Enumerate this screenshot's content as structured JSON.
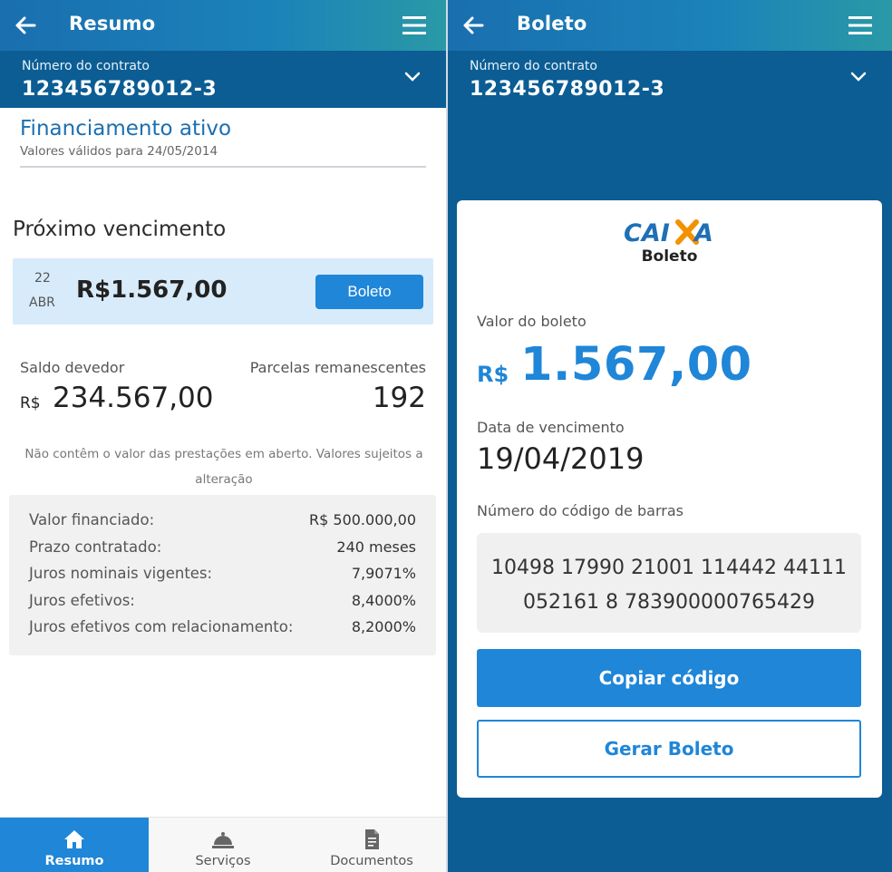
{
  "left": {
    "appbar": {
      "title": "Resumo"
    },
    "contract": {
      "label": "Número do contrato",
      "number": "123456789012-3"
    },
    "financing": {
      "title": "Financiamento ativo",
      "subtitle": "Valores válidos para 24/05/2014"
    },
    "next_due": {
      "title": "Próximo vencimento",
      "day": "22",
      "month": "ABR",
      "value": "R$1.567,00",
      "button_label": "Boleto"
    },
    "balance": {
      "label": "Saldo devedor",
      "currency": "R$",
      "value": "234.567,00",
      "remaining_label": "Parcelas remanescentes",
      "remaining_value": "192"
    },
    "note": "Não contêm o valor das prestações em aberto. Valores sujeitos a alteração",
    "details": [
      {
        "label": "Valor financiado:",
        "value": "R$ 500.000,00"
      },
      {
        "label": "Prazo contratado:",
        "value": "240 meses"
      },
      {
        "label": "Juros nominais vigentes:",
        "value": "7,9071%"
      },
      {
        "label": "Juros efetivos:",
        "value": "8,4000%"
      },
      {
        "label": "Juros efetivos com relacionamento:",
        "value": "8,2000%"
      }
    ],
    "bottom_nav": [
      {
        "label": "Resumo",
        "icon": "home-icon",
        "active": true
      },
      {
        "label": "Serviços",
        "icon": "service-bell-icon",
        "active": false
      },
      {
        "label": "Documentos",
        "icon": "document-icon",
        "active": false
      }
    ]
  },
  "right": {
    "appbar": {
      "title": "Boleto"
    },
    "contract": {
      "label": "Número do contrato",
      "number": "123456789012-3"
    },
    "card": {
      "logo_text": "CAIXA",
      "logo_subtitle": "Boleto",
      "value_label": "Valor do boleto",
      "value_currency": "R$",
      "value": "1.567,00",
      "due_label": "Data de vencimento",
      "due_date": "19/04/2019",
      "barcode_label": "Número do código de barras",
      "barcode_line1": "10498 17990 21001 114442 44111",
      "barcode_line2": "052161 8 783900000765429",
      "copy_button": "Copiar código",
      "generate_button": "Gerar Boleto"
    }
  },
  "colors": {
    "primary": "#1f86d8",
    "dark_blue": "#0b5d94",
    "title_blue": "#1b6fb1",
    "logo_orange": "#f39200",
    "highlight": "#d8ebfb"
  }
}
